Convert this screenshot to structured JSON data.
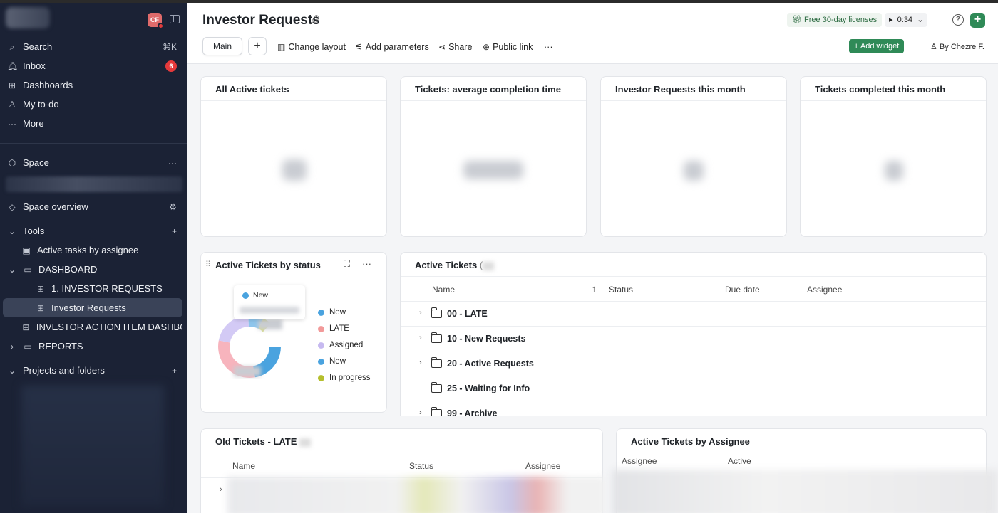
{
  "sidebar": {
    "avatar_text": "CF",
    "nav": [
      {
        "label": "Search",
        "shortcut": "⌘K"
      },
      {
        "label": "Inbox",
        "badge": "6"
      },
      {
        "label": "Dashboards"
      },
      {
        "label": "My to-do"
      },
      {
        "label": "More"
      }
    ],
    "space_label": "Space",
    "space_overview": "Space overview",
    "tools_label": "Tools",
    "tree": [
      {
        "label": "Active tasks by assignee"
      },
      {
        "label": "DASHBOARD"
      },
      {
        "label": "1. INVESTOR REQUESTS"
      },
      {
        "label": "Investor Requests"
      },
      {
        "label": "INVESTOR ACTION ITEM DASHBO..."
      },
      {
        "label": "REPORTS"
      }
    ],
    "projects_label": "Projects and folders"
  },
  "header": {
    "title": "Investor Requests",
    "license_label": "Free 30-day licenses",
    "timer": "0:34",
    "tab_main": "Main",
    "toolbar": {
      "change_layout": "Change layout",
      "add_parameters": "Add parameters",
      "share": "Share",
      "public_link": "Public link"
    },
    "add_widget": "Add widget",
    "by": "By Chezre F."
  },
  "widgets": {
    "kpi": [
      {
        "title": "All Active tickets"
      },
      {
        "title": "Tickets: average completion time"
      },
      {
        "title": "Investor Requests this month"
      },
      {
        "title": "Tickets completed this month"
      }
    ],
    "status_chart": {
      "title": "Active Tickets by status",
      "tooltip_label": "New",
      "legend": [
        {
          "label": "New",
          "color": "#4aa3df"
        },
        {
          "label": "LATE",
          "color": "#f29a9a"
        },
        {
          "label": "Assigned",
          "color": "#c6b9f0"
        },
        {
          "label": "New",
          "color": "#4aa3df"
        },
        {
          "label": "In progress",
          "color": "#b5bf2d"
        }
      ]
    },
    "active_tickets": {
      "title": "Active Tickets",
      "count_suffix": "(",
      "columns": [
        "Name",
        "Status",
        "Due date",
        "Assignee"
      ],
      "rows": [
        {
          "name": "00 - LATE",
          "expandable": true
        },
        {
          "name": "10 - New Requests",
          "expandable": true
        },
        {
          "name": "20 - Active Requests",
          "expandable": true
        },
        {
          "name": "25 - Waiting for Info",
          "expandable": false
        },
        {
          "name": "99 - Archive",
          "expandable": true
        }
      ]
    },
    "old_tickets": {
      "title": "Old Tickets - LATE",
      "columns": [
        "Name",
        "Status",
        "Assignee"
      ]
    },
    "by_assignee": {
      "title": "Active Tickets by Assignee",
      "columns": [
        "Assignee",
        "Active"
      ]
    }
  }
}
